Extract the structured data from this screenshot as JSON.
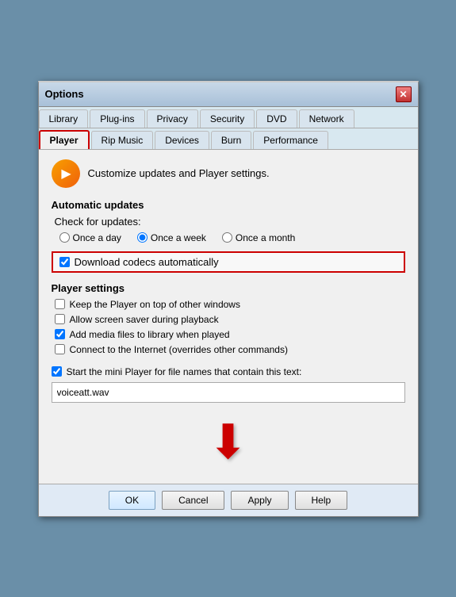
{
  "window": {
    "title": "Options",
    "close_label": "✕"
  },
  "tabs_row1": [
    {
      "id": "library",
      "label": "Library",
      "active": false
    },
    {
      "id": "plugins",
      "label": "Plug-ins",
      "active": false
    },
    {
      "id": "privacy",
      "label": "Privacy",
      "active": false
    },
    {
      "id": "security",
      "label": "Security",
      "active": false
    },
    {
      "id": "dvd",
      "label": "DVD",
      "active": false
    },
    {
      "id": "network",
      "label": "Network",
      "active": false
    }
  ],
  "tabs_row2": [
    {
      "id": "player",
      "label": "Player",
      "active": true
    },
    {
      "id": "rip_music",
      "label": "Rip Music",
      "active": false
    },
    {
      "id": "devices",
      "label": "Devices",
      "active": false
    },
    {
      "id": "burn",
      "label": "Burn",
      "active": false
    },
    {
      "id": "performance",
      "label": "Performance",
      "active": false
    }
  ],
  "header": {
    "description": "Customize updates and Player settings."
  },
  "automatic_updates": {
    "section_label": "Automatic updates",
    "check_label": "Check for updates:",
    "radio_options": [
      {
        "id": "once_a_day",
        "label": "Once a day",
        "checked": false
      },
      {
        "id": "once_a_week",
        "label": "Once a week",
        "checked": true
      },
      {
        "id": "once_a_month",
        "label": "Once a month",
        "checked": false
      }
    ],
    "download_codecs_label": "Download codecs automatically",
    "download_codecs_checked": true
  },
  "player_settings": {
    "section_label": "Player settings",
    "checkboxes": [
      {
        "id": "keep_on_top",
        "label": "Keep the Player on top of other windows",
        "checked": false
      },
      {
        "id": "allow_screensaver",
        "label": "Allow screen saver during playback",
        "checked": false
      },
      {
        "id": "add_media_files",
        "label": "Add media files to library when played",
        "checked": true
      },
      {
        "id": "connect_internet",
        "label": "Connect to the Internet (overrides other commands)",
        "checked": false
      }
    ]
  },
  "mini_player": {
    "checkbox_label": "Start the mini Player for file names that contain this text:",
    "checked": true,
    "input_value": "voiceatt.wav",
    "input_placeholder": ""
  },
  "footer": {
    "ok_label": "OK",
    "cancel_label": "Cancel",
    "apply_label": "Apply",
    "help_label": "Help"
  }
}
